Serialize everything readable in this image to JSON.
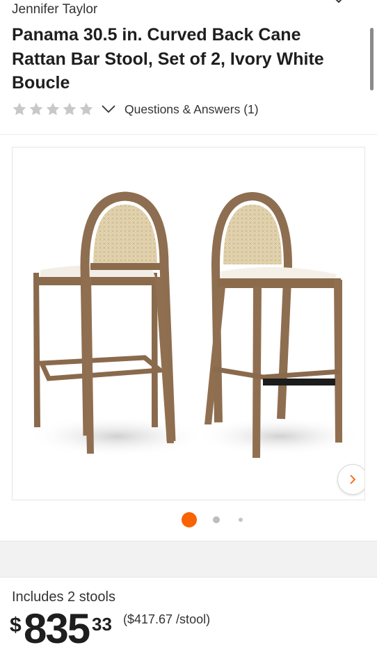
{
  "header": {
    "brand": "Jennifer Taylor",
    "title": "Panama 30.5 in. Curved Back Cane Rattan Bar Stool, Set of 2, Ivory White Boucle"
  },
  "rating": {
    "stars_filled": 0,
    "stars_total": 5,
    "qa_label": "Questions & Answers (1)"
  },
  "gallery": {
    "image_alt": "Two Panama bar stools with cane rattan backs and ivory boucle seats",
    "current_index": 1,
    "total_dots": 3
  },
  "pricing": {
    "includes": "Includes 2 stools",
    "currency": "$",
    "whole": "835",
    "cents": "33",
    "unit_price": "($417.67 /stool)"
  },
  "colors": {
    "accent": "#f96302",
    "text": "#1e1e1e",
    "star_empty": "#c8c8c8"
  },
  "icons": {
    "star": "star-icon",
    "chevron_down": "chevron-down-icon",
    "chevron_right": "chevron-right-icon"
  }
}
